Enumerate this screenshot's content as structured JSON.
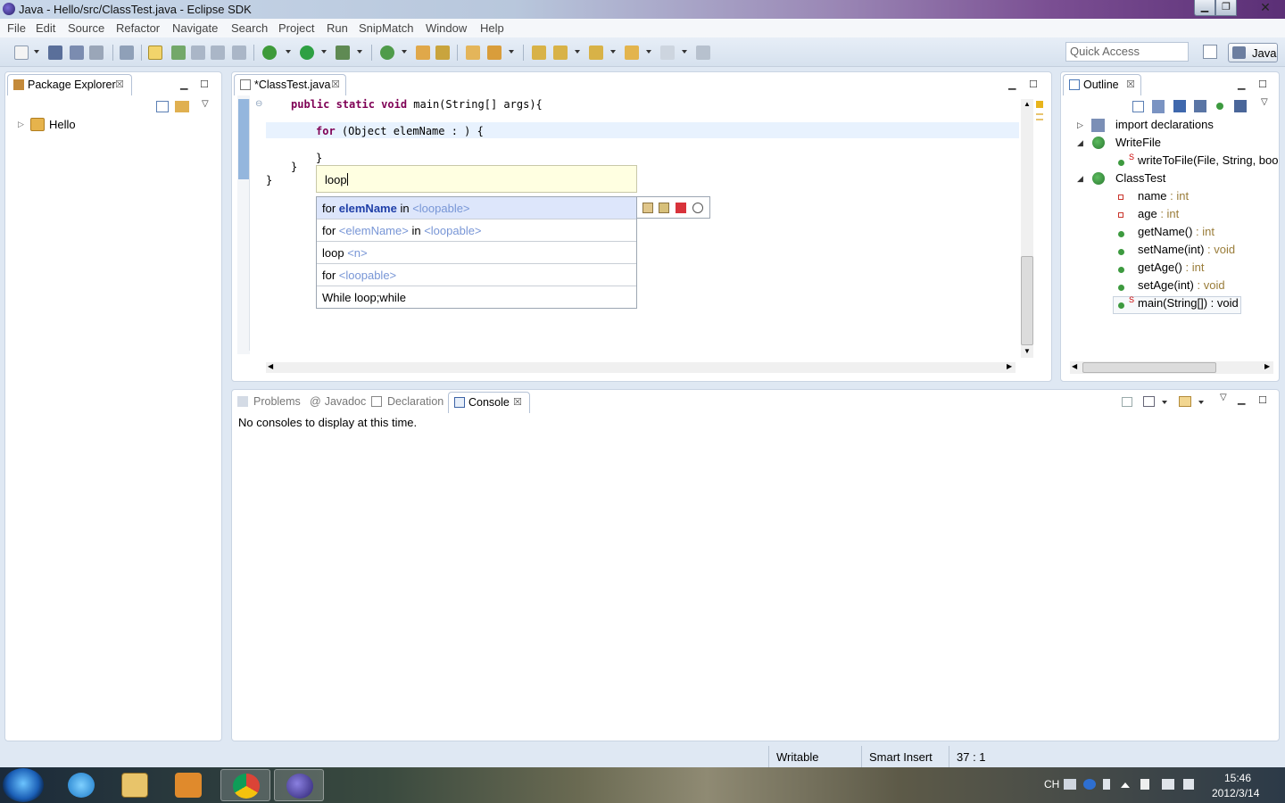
{
  "window": {
    "title": "Java - Hello/src/ClassTest.java - Eclipse SDK",
    "minimize": "▁",
    "maximize": "❐",
    "close": "✕"
  },
  "menu": [
    "File",
    "Edit",
    "Source",
    "Refactor",
    "Navigate",
    "Search",
    "Project",
    "Run",
    "SnipMatch",
    "Window",
    "Help"
  ],
  "toolbar": {
    "quick_access_placeholder": "Quick Access",
    "perspective": "Java"
  },
  "package_explorer": {
    "tab_label": "Package Explorer",
    "tree": [
      {
        "label": "Hello",
        "expanded": false
      }
    ]
  },
  "editor": {
    "tab_label": "*ClassTest.java",
    "code": {
      "line1_kw": "public static void",
      "line1_rest": " main(String[] args){",
      "line2_kw": "for",
      "line2_rest": " (Object elemName : ) {",
      "line3": "}",
      "line4": "}",
      "line5": "}"
    },
    "content_assist": {
      "filter": "loop",
      "proposals": [
        {
          "p1": "for ",
          "p2": "elemName",
          "p3": " in ",
          "p4": "<loopable>",
          "selected": true
        },
        {
          "p1": "for ",
          "p2": "<elemName>",
          "p3": " in ",
          "p4": "<loopable>",
          "selected": false
        },
        {
          "p1": "loop ",
          "p2": "<n>",
          "p3": "",
          "p4": "",
          "selected": false
        },
        {
          "p1": "for ",
          "p2": "<loopable>",
          "p3": "",
          "p4": "",
          "selected": false
        },
        {
          "p1": "While loop;while",
          "p2": "",
          "p3": "",
          "p4": "",
          "selected": false
        }
      ]
    }
  },
  "outline": {
    "tab_label": "Outline",
    "items": [
      {
        "label": "import declarations",
        "type": ""
      },
      {
        "label": "WriteFile",
        "type": ""
      },
      {
        "label": "writeToFile(File, String, boo",
        "type": ""
      },
      {
        "label": "ClassTest",
        "type": ""
      },
      {
        "label": "name",
        "type": " : int"
      },
      {
        "label": "age",
        "type": " : int"
      },
      {
        "label": "getName()",
        "type": " : int"
      },
      {
        "label": "setName(int)",
        "type": " : void"
      },
      {
        "label": "getAge()",
        "type": " : int"
      },
      {
        "label": "setAge(int)",
        "type": " : void"
      },
      {
        "label": "main(String[])",
        "type": " : void"
      }
    ]
  },
  "bottom_panel": {
    "tabs": [
      "Problems",
      "Javadoc",
      "Declaration",
      "Console"
    ],
    "active_tab": "Console",
    "console_message": "No consoles to display at this time."
  },
  "statusbar": {
    "writable": "Writable",
    "insert_mode": "Smart Insert",
    "position": "37 : 1"
  },
  "taskbar": {
    "ime": "CH",
    "time": "15:46",
    "date": "2012/3/14"
  },
  "colors": {
    "keyword": "#7f0055",
    "placeholder": "#7896d6",
    "selection": "#dde6fb",
    "filter_bg": "#ffffe1"
  }
}
